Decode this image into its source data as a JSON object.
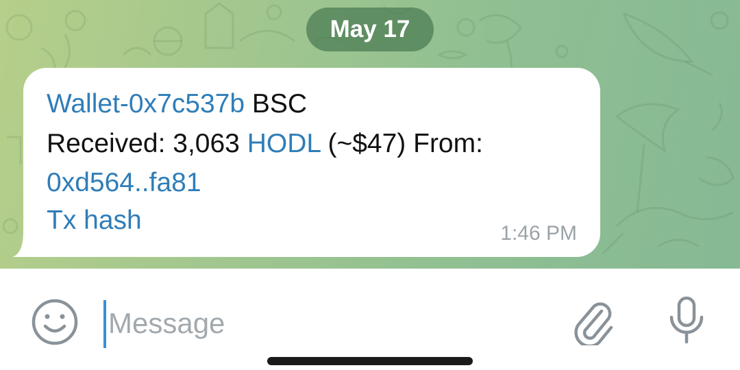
{
  "chat": {
    "date_separator": "May 17",
    "message": {
      "wallet_link": "Wallet-0x7c537b",
      "network": "BSC",
      "received_label": "Received: 3,063",
      "token_link": "HODL",
      "amount_from": "(~$47) From:",
      "sender_link": "0xd564..fa81",
      "tx_link": "Tx hash",
      "time": "1:46 PM"
    }
  },
  "composer": {
    "placeholder": "Message",
    "emoji_icon": "smiley-face-icon",
    "attach_icon": "paperclip-icon",
    "mic_icon": "microphone-icon"
  },
  "colors": {
    "link": "#2f7db8",
    "caret": "#3b8fd6",
    "bubble": "#ffffff"
  }
}
